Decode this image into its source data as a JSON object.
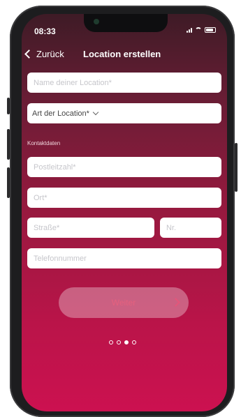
{
  "status_bar": {
    "time": "08:33"
  },
  "nav": {
    "back_label": "Zurück",
    "title": "Location erstellen"
  },
  "form": {
    "location_name_placeholder": "Name deiner Location*",
    "location_type_value": "Art der Location*",
    "section_label": "Kontaktdaten",
    "postcode_placeholder": "Postleitzahl*",
    "city_placeholder": "Ort*",
    "street_placeholder": "Straße*",
    "house_number_placeholder": "Nr.",
    "phone_placeholder": "Telefonnummer"
  },
  "actions": {
    "next_label": "Weiter"
  },
  "pager": {
    "total": 4,
    "active_index": 2
  },
  "colors": {
    "accent": "#cc1150",
    "gradient_top": "#3e1b26",
    "button_text": "#e6607e"
  }
}
